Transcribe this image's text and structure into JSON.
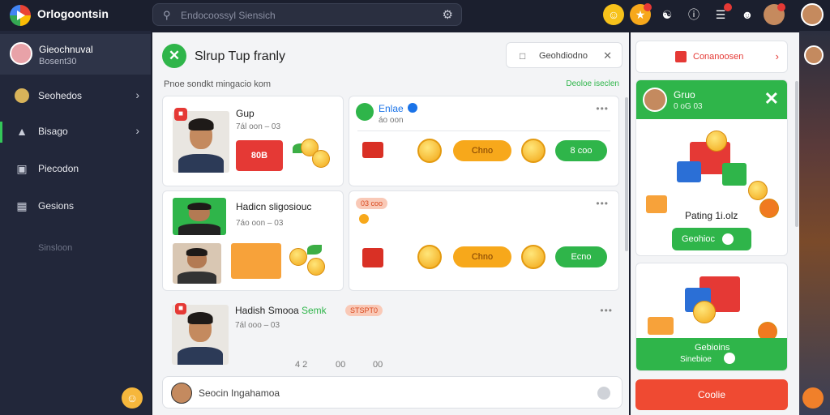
{
  "app": {
    "title": "Orlogoontsin"
  },
  "search": {
    "placeholder": "Endocoossyl Siensich"
  },
  "sidebar": {
    "user": {
      "name": "Gieochnuval",
      "subtitle": "Bosent30"
    },
    "items": [
      {
        "label": "Seohedos",
        "icon": "user-icon"
      },
      {
        "label": "Bisago",
        "icon": "graduation-icon"
      },
      {
        "label": "Piecodon",
        "icon": "book-icon"
      },
      {
        "label": "Gesions",
        "icon": "trash-icon"
      }
    ],
    "muted_label": "Sinsloon"
  },
  "main": {
    "header_title": "Slrup Tup franly",
    "header_button": "Geohdiodno",
    "sub_left": "Pnoe sondkt mingacio kom",
    "sub_right": "Deoloe iseclen",
    "cards": [
      {
        "title": "Gup",
        "subtitle": "7ál oon – 03",
        "gift_label": "80B"
      },
      {
        "title": "Hadicn sligosiouc",
        "subtitle": "7áo oon – 03"
      },
      {
        "title": "Hadish Smooa",
        "title_accent": "Semk",
        "subtitle": "7ál ooo – 03",
        "tag": "STSPT0"
      }
    ],
    "posts": [
      {
        "title": "Enlae",
        "subtitle": "áo oon",
        "chip_orange": "Chno",
        "chip_green": "8 coo"
      },
      {
        "tag": "03 coo",
        "chip_orange": "Chno",
        "chip_green": "Ecno"
      }
    ],
    "reactions": [
      "4 2",
      "00",
      "00"
    ],
    "composer_placeholder": "Seocin Ingahamoa"
  },
  "right": {
    "top_label": "Conanoosen",
    "card": {
      "name": "Gruo",
      "subtitle": "0 oG 03",
      "caption": "Pating 1i.olz",
      "button": "Geohioc"
    },
    "card2": {
      "title": "Gebioins",
      "subtitle": "Sinebioe"
    },
    "cta": "Coolie"
  },
  "colors": {
    "accent_green": "#2fb54a",
    "accent_red": "#ef4a32",
    "accent_orange": "#f7a81b",
    "topbar_bg": "#1b1f2e"
  }
}
